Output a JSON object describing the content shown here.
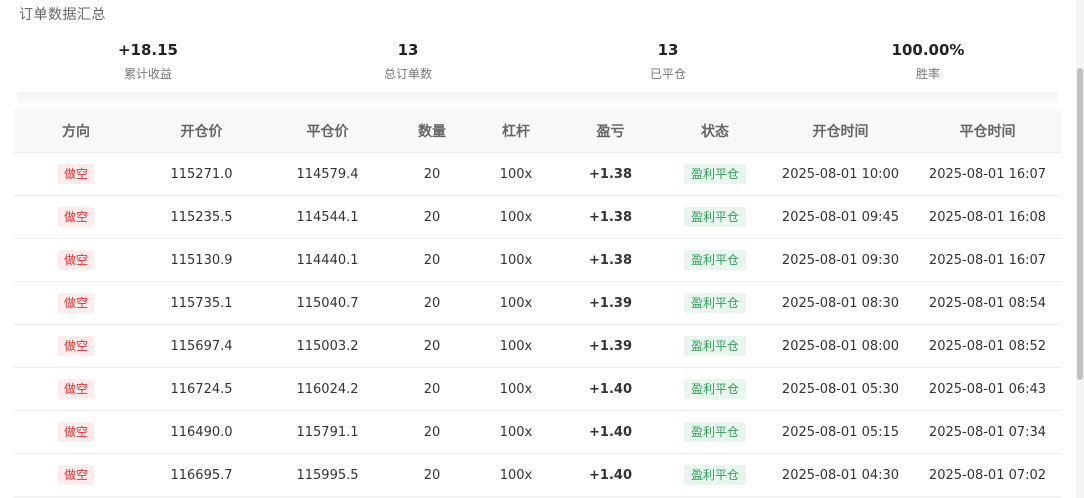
{
  "section_title": "订单数据汇总",
  "stats": [
    {
      "value": "+18.15",
      "label": "累计收益"
    },
    {
      "value": "13",
      "label": "总订单数"
    },
    {
      "value": "13",
      "label": "已平仓"
    },
    {
      "value": "100.00%",
      "label": "胜率"
    }
  ],
  "table": {
    "headers": [
      "方向",
      "开仓价",
      "平仓价",
      "数量",
      "杠杆",
      "盈亏",
      "状态",
      "开仓时间",
      "平仓时间"
    ],
    "rows": [
      {
        "direction": "做空",
        "open_price": "115271.0",
        "close_price": "114579.4",
        "qty": "20",
        "leverage": "100x",
        "pnl": "+1.38",
        "status": "盈利平仓",
        "open_time": "2025-08-01 10:00",
        "close_time": "2025-08-01 16:07"
      },
      {
        "direction": "做空",
        "open_price": "115235.5",
        "close_price": "114544.1",
        "qty": "20",
        "leverage": "100x",
        "pnl": "+1.38",
        "status": "盈利平仓",
        "open_time": "2025-08-01 09:45",
        "close_time": "2025-08-01 16:08"
      },
      {
        "direction": "做空",
        "open_price": "115130.9",
        "close_price": "114440.1",
        "qty": "20",
        "leverage": "100x",
        "pnl": "+1.38",
        "status": "盈利平仓",
        "open_time": "2025-08-01 09:30",
        "close_time": "2025-08-01 16:07"
      },
      {
        "direction": "做空",
        "open_price": "115735.1",
        "close_price": "115040.7",
        "qty": "20",
        "leverage": "100x",
        "pnl": "+1.39",
        "status": "盈利平仓",
        "open_time": "2025-08-01 08:30",
        "close_time": "2025-08-01 08:54"
      },
      {
        "direction": "做空",
        "open_price": "115697.4",
        "close_price": "115003.2",
        "qty": "20",
        "leverage": "100x",
        "pnl": "+1.39",
        "status": "盈利平仓",
        "open_time": "2025-08-01 08:00",
        "close_time": "2025-08-01 08:52"
      },
      {
        "direction": "做空",
        "open_price": "116724.5",
        "close_price": "116024.2",
        "qty": "20",
        "leverage": "100x",
        "pnl": "+1.40",
        "status": "盈利平仓",
        "open_time": "2025-08-01 05:30",
        "close_time": "2025-08-01 06:43"
      },
      {
        "direction": "做空",
        "open_price": "116490.0",
        "close_price": "115791.1",
        "qty": "20",
        "leverage": "100x",
        "pnl": "+1.40",
        "status": "盈利平仓",
        "open_time": "2025-08-01 05:15",
        "close_time": "2025-08-01 07:34"
      },
      {
        "direction": "做空",
        "open_price": "116695.7",
        "close_price": "115995.5",
        "qty": "20",
        "leverage": "100x",
        "pnl": "+1.40",
        "status": "盈利平仓",
        "open_time": "2025-08-01 04:30",
        "close_time": "2025-08-01 07:02"
      }
    ]
  },
  "colors": {
    "short_tag_text": "#e03131",
    "short_tag_bg": "#fdecec",
    "status_text": "#2f9e5a",
    "status_bg": "#e8f6ee"
  }
}
